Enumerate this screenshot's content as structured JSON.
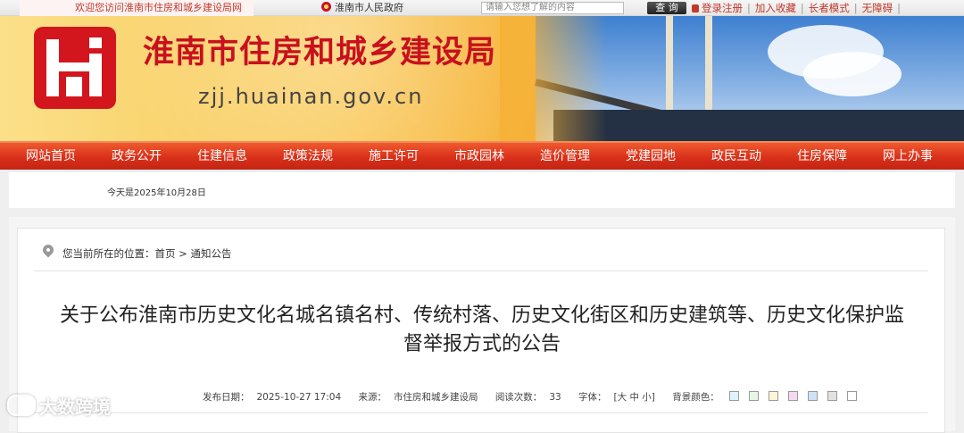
{
  "topbar": {
    "welcome": "欢迎您访问淮南市住房和城乡建设局网站!",
    "gov_link": "淮南市人民政府",
    "search_placeholder": "请输入您想了解的内容",
    "search_button": "查 询",
    "links": [
      "登录注册",
      "加入收藏",
      "长者模式",
      "无障碍"
    ]
  },
  "banner": {
    "site_title": "淮南市住房和城乡建设局",
    "site_url": "zjj.huainan.gov.cn"
  },
  "nav": {
    "items": [
      "网站首页",
      "政务公开",
      "住建信息",
      "政策法规",
      "施工许可",
      "市政园林",
      "造价管理",
      "党建园地",
      "政民互动",
      "住房保障",
      "网上办事"
    ]
  },
  "date": "今天是2025年10月28日",
  "breadcrumb": {
    "label": "您当前所在的位置：",
    "home": "首页",
    "separator": ">",
    "current": "通知公告"
  },
  "article": {
    "title_line1": "关于公布淮南市历史文化名城名镇名村、传统村落、历史文化街区和历史建筑等、历史文化保护监",
    "title_line2": "督举报方式的公告",
    "publish_label": "发布日期：",
    "publish_date": "2025-10-27 17:04",
    "source_label": "来源：",
    "source": "市住房和城乡建设局",
    "views_label": "阅读次数：",
    "views": "33",
    "font_label": "字体：",
    "font_options": "[大 中 小]",
    "bg_label": "背景颜色：",
    "bg_colors": [
      "#dff3ff",
      "#e6f7e6",
      "#fff5d6",
      "#f5d9f0",
      "#cfe3f7",
      "#e2e2e2",
      "#ffffff"
    ]
  },
  "watermark": "大数跨境"
}
